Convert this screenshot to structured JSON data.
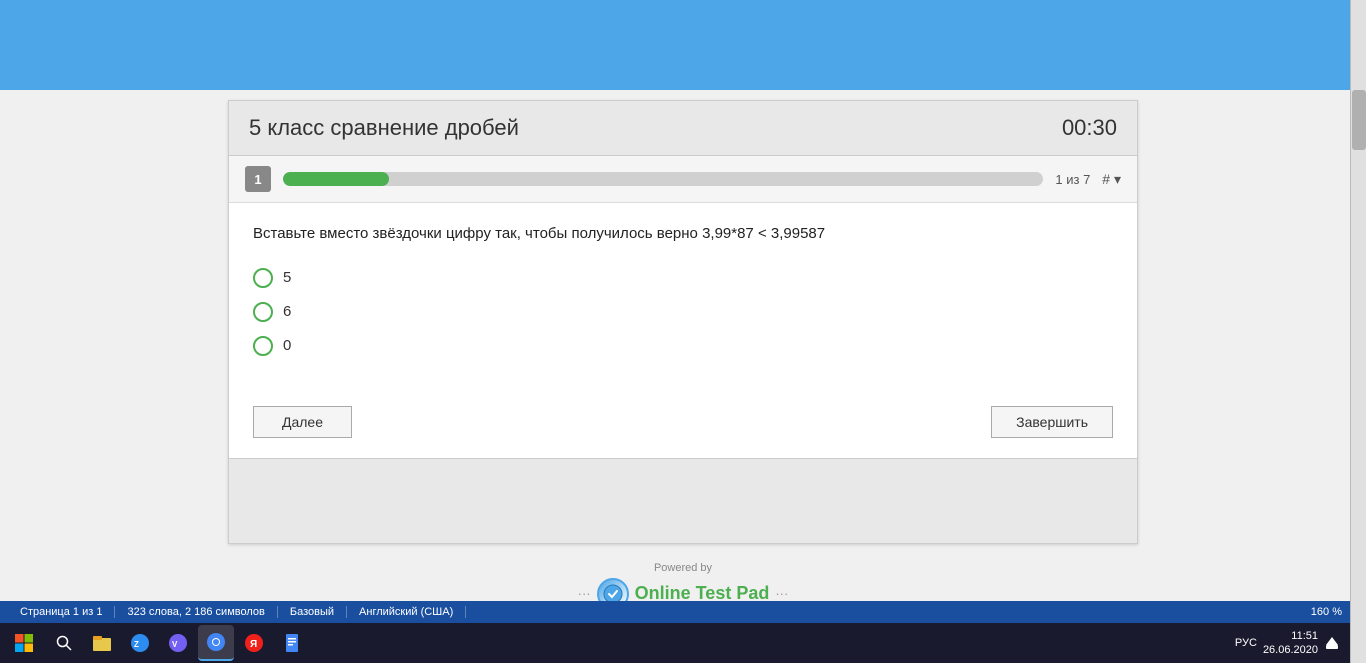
{
  "header": {
    "bg_color": "#4da6e8"
  },
  "quiz": {
    "title": "5 класс сравнение дробей",
    "timer": "00:30",
    "progress": {
      "question_number": "1",
      "bar_width_percent": 14,
      "label": "1 из 7",
      "hash_label": "# ▾"
    },
    "question_text": "Вставьте вместо звёздочки цифру так, чтобы получилось верно   3,99*87 < 3,99587",
    "options": [
      {
        "label": "5"
      },
      {
        "label": "6"
      },
      {
        "label": "0"
      }
    ],
    "btn_next": "Далее",
    "btn_finish": "Завершить"
  },
  "footer": {
    "powered_text": "Powered by",
    "brand_name": "Online Test Pad",
    "dots_left": "···",
    "dots_right": "···"
  },
  "statusbar": {
    "page_info": "Страница 1 из 1",
    "word_count": "323 слова, 2 186 символов",
    "style": "Базовый",
    "language": "Английский (США)",
    "zoom": "160 %"
  },
  "taskbar": {
    "time": "11:51",
    "date": "26.06.2020",
    "language": "РУС"
  }
}
